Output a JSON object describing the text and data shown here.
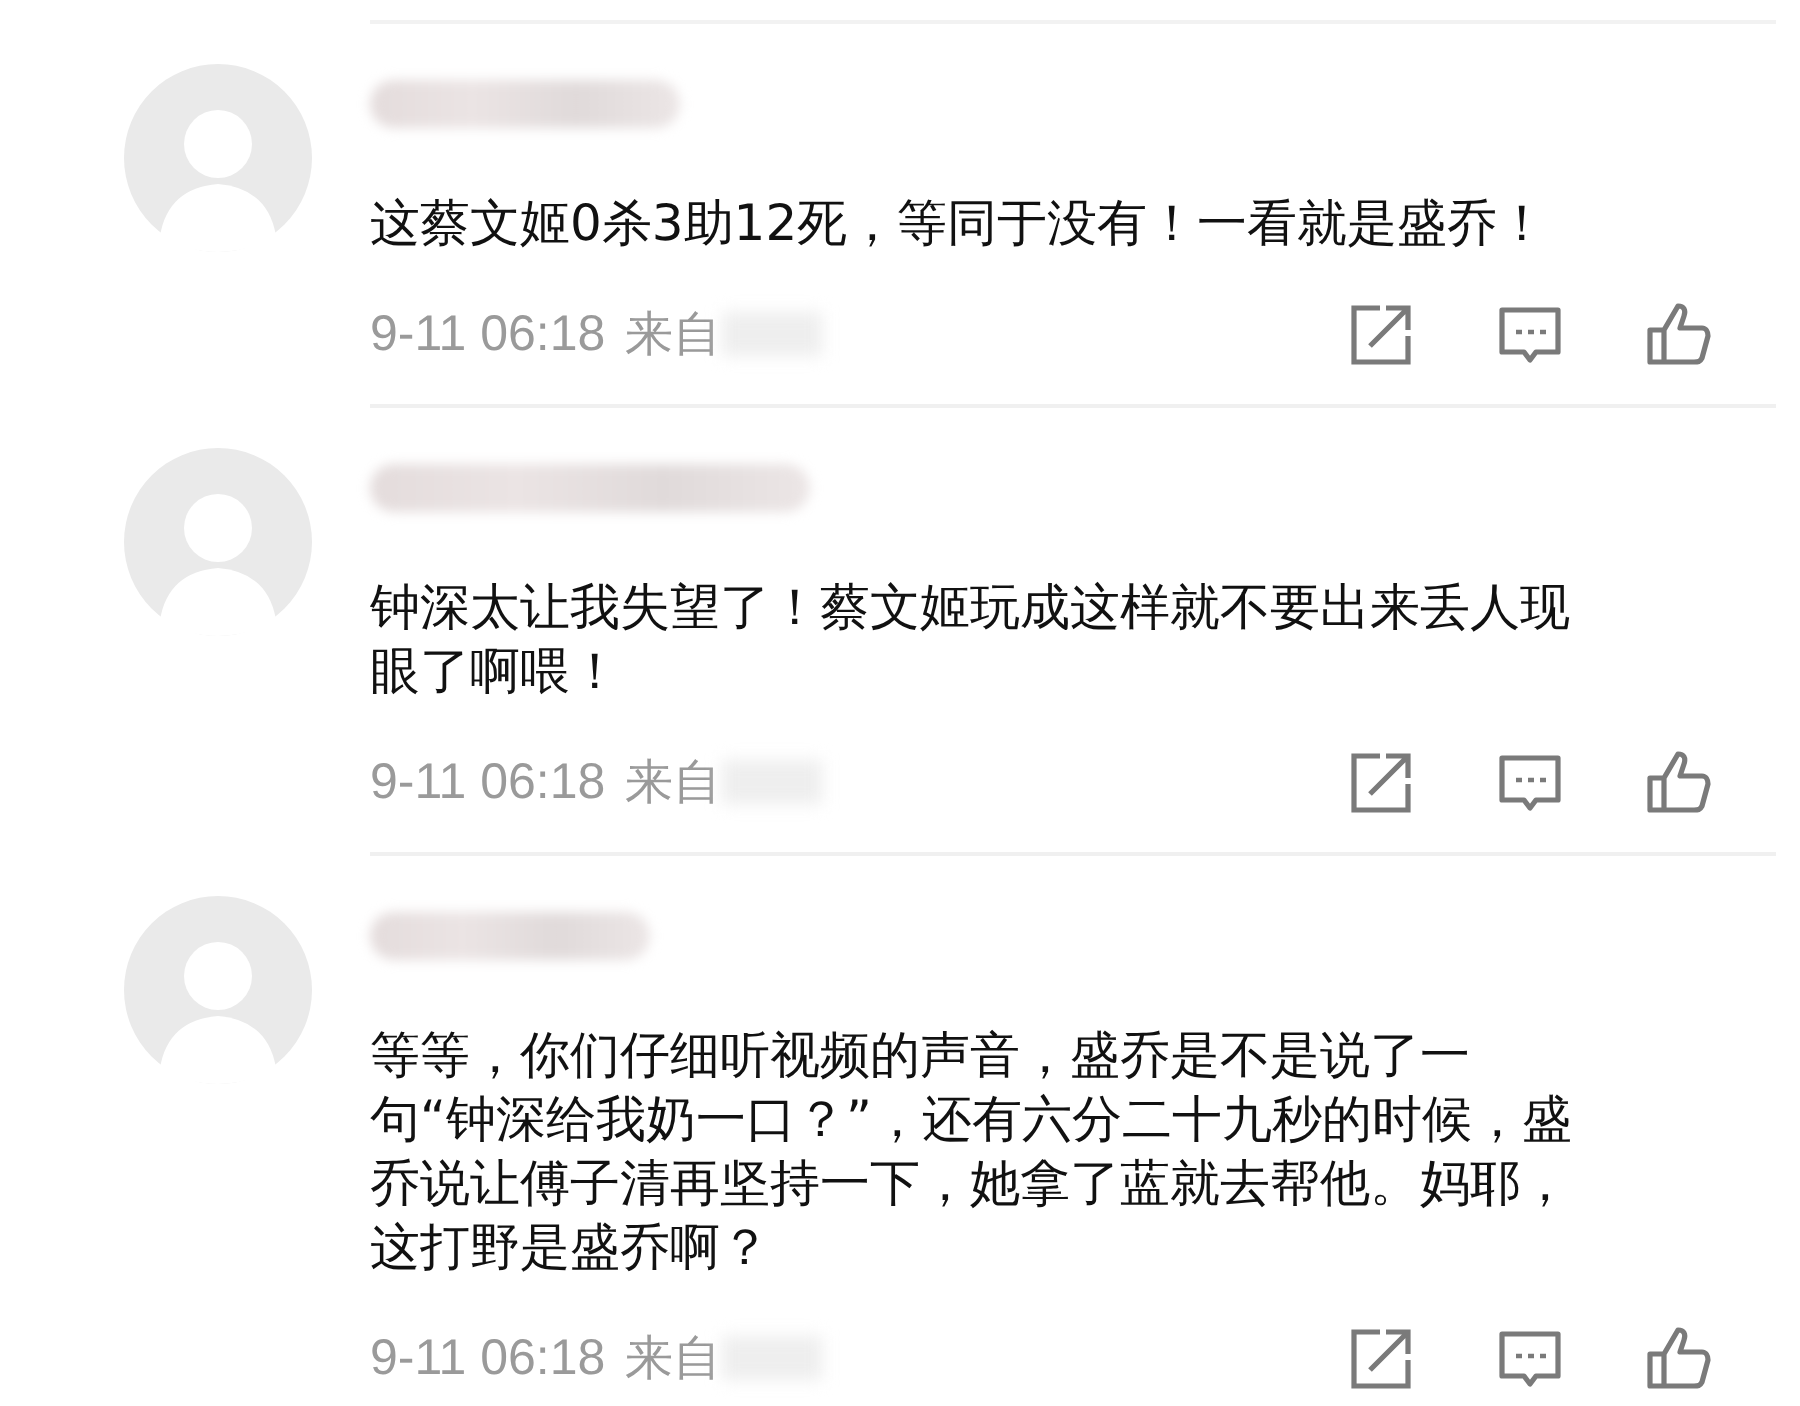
{
  "comments": [
    {
      "text": "这蔡文姬0杀3助12死，等同于没有！一看就是盛乔！",
      "time": "9-11 06:18",
      "source_prefix": "来自"
    },
    {
      "text": "钟深太让我失望了！蔡文姬玩成这样就不要出来丢人现眼了啊喂！",
      "time": "9-11 06:18",
      "source_prefix": "来自"
    },
    {
      "text": "等等，你们仔细听视频的声音，盛乔是不是说了一句“钟深给我奶一口？”，还有六分二十九秒的时候，盛乔说让傅子清再坚持一下，她拿了蓝就去帮他。妈耶，这打野是盛乔啊？",
      "time": "9-11 06:18",
      "source_prefix": "来自"
    }
  ]
}
